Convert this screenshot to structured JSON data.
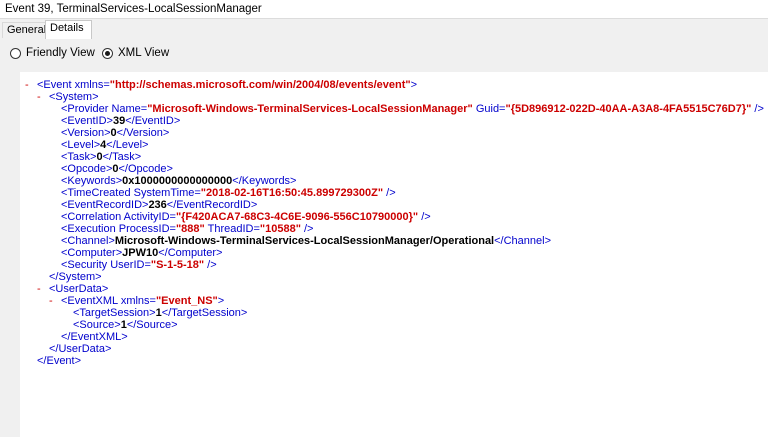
{
  "window": {
    "title": "Event 39, TerminalServices-LocalSessionManager"
  },
  "tabs": {
    "general": "General",
    "details": "Details"
  },
  "view": {
    "friendly": "Friendly View",
    "xml": "XML View"
  },
  "xml": {
    "lines": [
      {
        "collapse": "-",
        "parts": [
          [
            "tag",
            "<Event xmlns="
          ],
          [
            "aval",
            "\"http://schemas.microsoft.com/win/2004/08/events/event\""
          ],
          [
            "tag",
            ">"
          ]
        ]
      },
      {
        "collapse": "-",
        "parts": [
          [
            "tag",
            "<System>"
          ]
        ]
      },
      {
        "parts": [
          [
            "tag",
            "<Provider Name="
          ],
          [
            "aval",
            "\"Microsoft-Windows-TerminalServices-LocalSessionManager\""
          ],
          [
            "tag",
            " Guid="
          ],
          [
            "aval",
            "\"{5D896912-022D-40AA-A3A8-4FA5515C76D7}\""
          ],
          [
            "tag",
            " />"
          ]
        ]
      },
      {
        "parts": [
          [
            "tag",
            "<EventID>"
          ],
          [
            "val",
            "39"
          ],
          [
            "tag",
            "</EventID>"
          ]
        ]
      },
      {
        "parts": [
          [
            "tag",
            "<Version>"
          ],
          [
            "val",
            "0"
          ],
          [
            "tag",
            "</Version>"
          ]
        ]
      },
      {
        "parts": [
          [
            "tag",
            "<Level>"
          ],
          [
            "val",
            "4"
          ],
          [
            "tag",
            "</Level>"
          ]
        ]
      },
      {
        "parts": [
          [
            "tag",
            "<Task>"
          ],
          [
            "val",
            "0"
          ],
          [
            "tag",
            "</Task>"
          ]
        ]
      },
      {
        "parts": [
          [
            "tag",
            "<Opcode>"
          ],
          [
            "val",
            "0"
          ],
          [
            "tag",
            "</Opcode>"
          ]
        ]
      },
      {
        "parts": [
          [
            "tag",
            "<Keywords>"
          ],
          [
            "val",
            "0x1000000000000000"
          ],
          [
            "tag",
            "</Keywords>"
          ]
        ]
      },
      {
        "parts": [
          [
            "tag",
            "<TimeCreated SystemTime="
          ],
          [
            "aval",
            "\"2018-02-16T16:50:45.899729300Z\""
          ],
          [
            "tag",
            " />"
          ]
        ]
      },
      {
        "parts": [
          [
            "tag",
            "<EventRecordID>"
          ],
          [
            "val",
            "236"
          ],
          [
            "tag",
            "</EventRecordID>"
          ]
        ]
      },
      {
        "parts": [
          [
            "tag",
            "<Correlation ActivityID="
          ],
          [
            "aval",
            "\"{F420ACA7-68C3-4C6E-9096-556C10790000}\""
          ],
          [
            "tag",
            " />"
          ]
        ]
      },
      {
        "parts": [
          [
            "tag",
            "<Execution ProcessID="
          ],
          [
            "aval",
            "\"888\""
          ],
          [
            "tag",
            " ThreadID="
          ],
          [
            "aval",
            "\"10588\""
          ],
          [
            "tag",
            " />"
          ]
        ]
      },
      {
        "parts": [
          [
            "tag",
            "<Channel>"
          ],
          [
            "val",
            "Microsoft-Windows-TerminalServices-LocalSessionManager/Operational"
          ],
          [
            "tag",
            "</Channel>"
          ]
        ]
      },
      {
        "parts": [
          [
            "tag",
            "<Computer>"
          ],
          [
            "val",
            "JPW10"
          ],
          [
            "tag",
            "</Computer>"
          ]
        ]
      },
      {
        "parts": [
          [
            "tag",
            "<Security UserID="
          ],
          [
            "aval",
            "\"S-1-5-18\""
          ],
          [
            "tag",
            " />"
          ]
        ]
      },
      {
        "parts": [
          [
            "tag",
            "</System>"
          ]
        ]
      },
      {
        "collapse": "-",
        "parts": [
          [
            "tag",
            "<UserData>"
          ]
        ]
      },
      {
        "collapse": "-",
        "parts": [
          [
            "tag",
            "<EventXML xmlns="
          ],
          [
            "aval",
            "\"Event_NS\""
          ],
          [
            "tag",
            ">"
          ]
        ]
      },
      {
        "parts": [
          [
            "tag",
            "<TargetSession>"
          ],
          [
            "val",
            "1"
          ],
          [
            "tag",
            "</TargetSession>"
          ]
        ]
      },
      {
        "parts": [
          [
            "tag",
            "<Source>"
          ],
          [
            "val",
            "1"
          ],
          [
            "tag",
            "</Source>"
          ]
        ]
      },
      {
        "parts": [
          [
            "tag",
            "</EventXML>"
          ]
        ]
      },
      {
        "parts": [
          [
            "tag",
            "</UserData>"
          ]
        ]
      },
      {
        "parts": [
          [
            "tag",
            "</Event>"
          ]
        ]
      }
    ]
  },
  "colors": {
    "tag": "#0000cc",
    "attribute_value": "#cc0000",
    "collapse": "#cc0000",
    "text_value": "#000000"
  }
}
